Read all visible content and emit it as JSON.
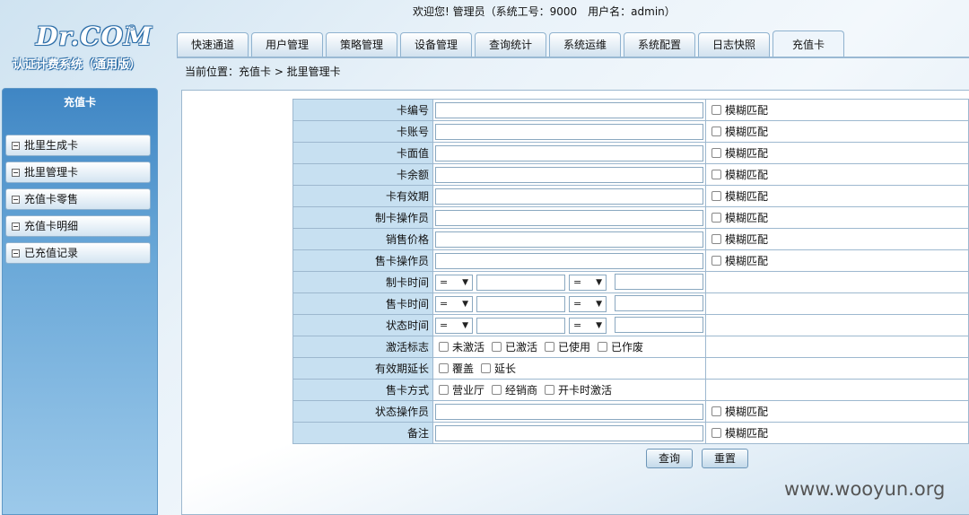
{
  "logo": {
    "mark": "Dr.COM",
    "reg": "®",
    "subtitle": "认证计费系统（通用版）"
  },
  "header": {
    "welcome": "欢迎您! 管理员（系统工号：9000　用户名：admin）"
  },
  "tabs": [
    {
      "label": "快速通道"
    },
    {
      "label": "用户管理"
    },
    {
      "label": "策略管理"
    },
    {
      "label": "设备管理"
    },
    {
      "label": "查询统计"
    },
    {
      "label": "系统运维"
    },
    {
      "label": "系统配置"
    },
    {
      "label": "日志快照"
    },
    {
      "label": "充值卡",
      "active": true
    }
  ],
  "breadcrumb": "当前位置：充值卡 > 批里管理卡",
  "sidebar": {
    "title": "充值卡",
    "items": [
      {
        "label": "批里生成卡"
      },
      {
        "label": "批里管理卡"
      },
      {
        "label": "充值卡零售"
      },
      {
        "label": "充值卡明细"
      },
      {
        "label": "已充值记录"
      }
    ]
  },
  "form": {
    "fuzzy_label": "模糊匹配",
    "text_rows": [
      {
        "label": "卡编号",
        "value": ""
      },
      {
        "label": "卡账号",
        "value": ""
      },
      {
        "label": "卡面值",
        "value": ""
      },
      {
        "label": "卡余额",
        "value": ""
      },
      {
        "label": "卡有效期",
        "value": ""
      },
      {
        "label": "制卡操作员",
        "value": ""
      },
      {
        "label": "销售价格",
        "value": ""
      },
      {
        "label": "售卡操作员",
        "value": ""
      }
    ],
    "time_rows": [
      {
        "label": "制卡时间",
        "op1": "=",
        "op2": "="
      },
      {
        "label": "售卡时间",
        "op1": "=",
        "op2": "="
      },
      {
        "label": "状态时间",
        "op1": "=",
        "op2": "="
      }
    ],
    "activation": {
      "label": "激活标志",
      "options": [
        "未激活",
        "已激活",
        "已使用",
        "已作废"
      ]
    },
    "extend": {
      "label": "有效期延长",
      "options": [
        "覆盖",
        "延长"
      ]
    },
    "sale_mode": {
      "label": "售卡方式",
      "options": [
        "营业厅",
        "经销商",
        "开卡时激活"
      ]
    },
    "status_operator": {
      "label": "状态操作员",
      "value": ""
    },
    "remark": {
      "label": "备注",
      "value": ""
    },
    "query_button": "查询",
    "reset_button": "重置"
  },
  "watermark": "www.wooyun.org"
}
